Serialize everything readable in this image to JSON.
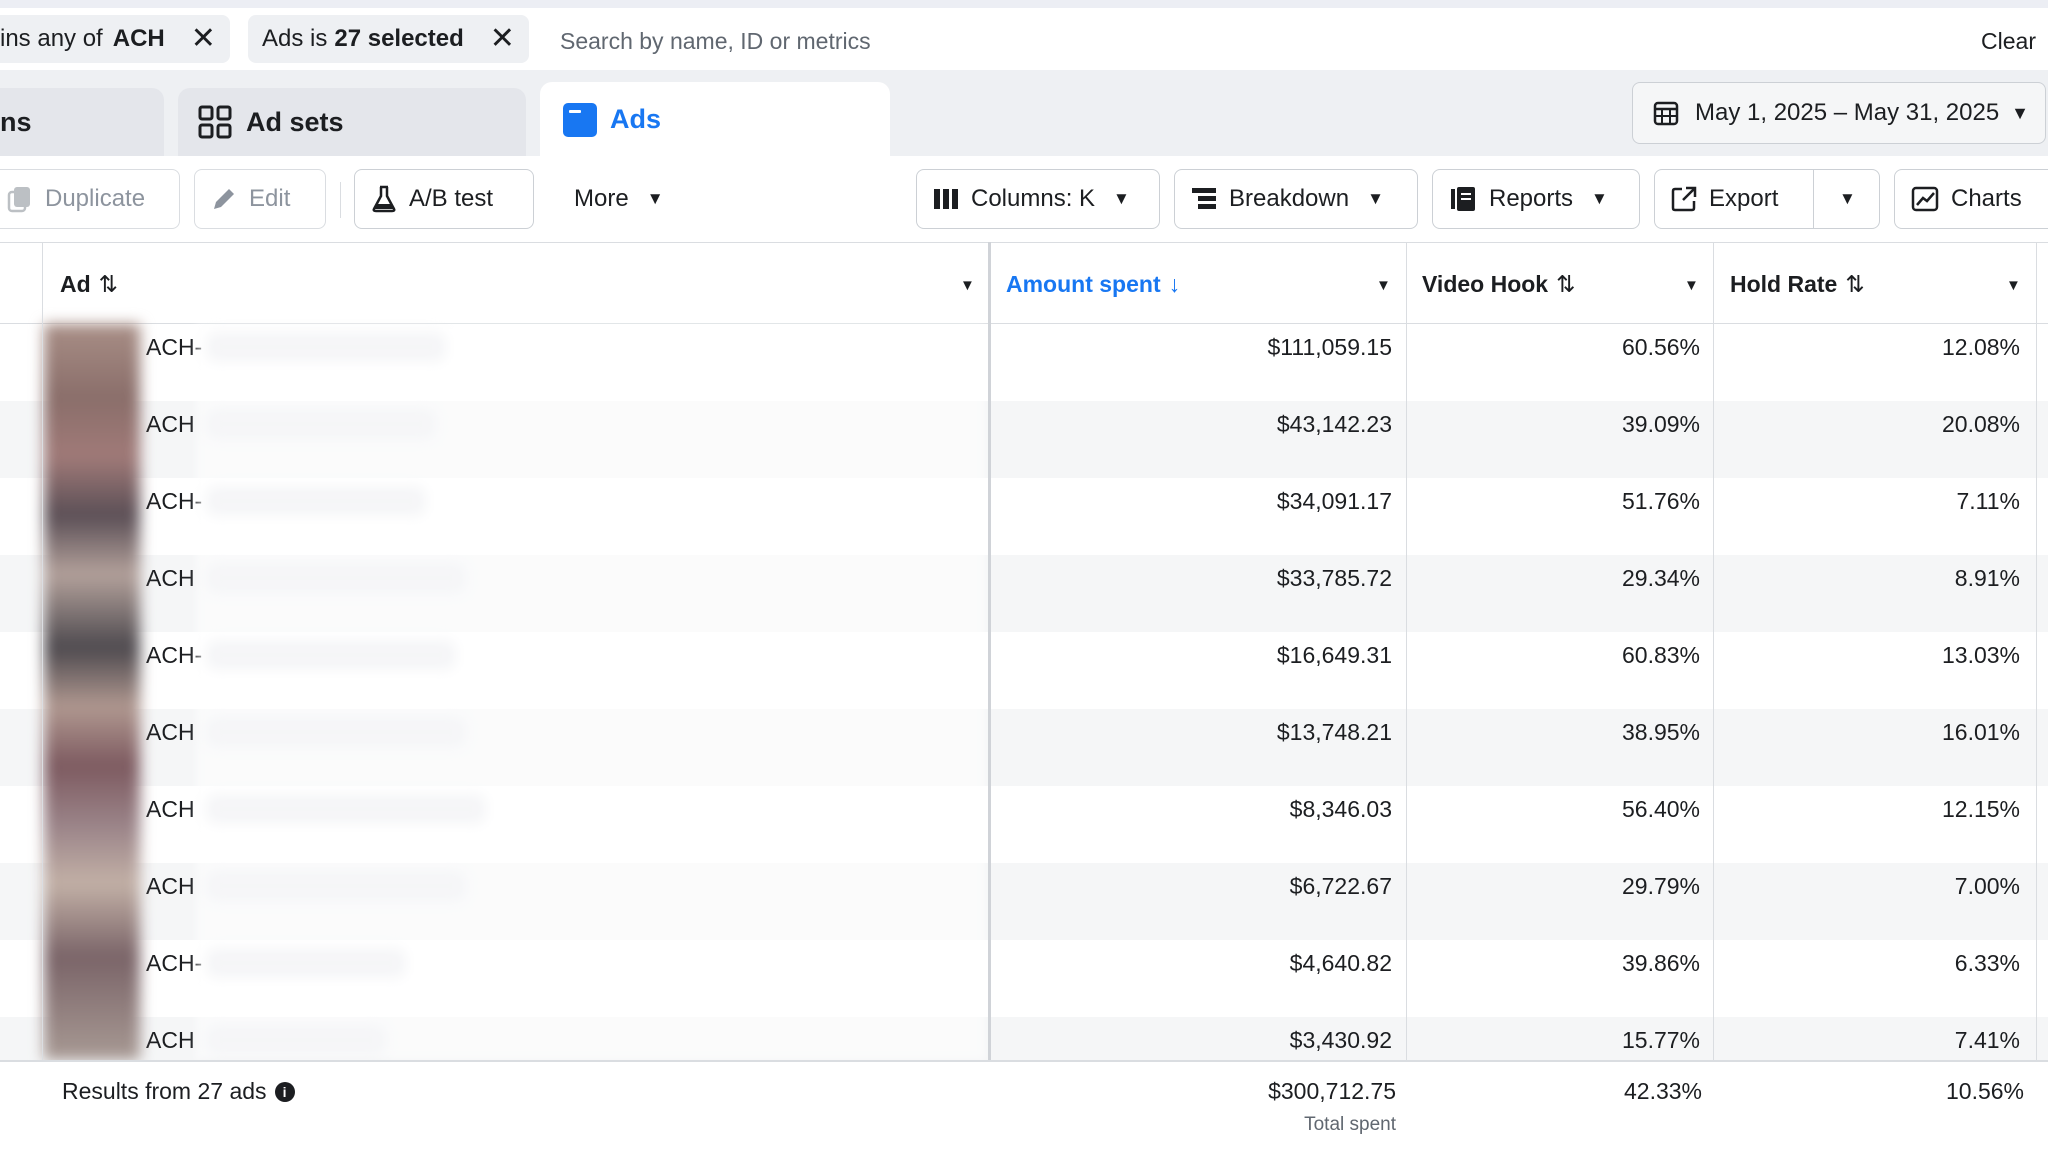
{
  "filters": {
    "chip1_prefix": "ins any of",
    "chip1_value": "ACH",
    "chip2_prefix": "Ads is",
    "chip2_value": "27 selected",
    "search_placeholder": "Search by name, ID or metrics",
    "clear_label": "Clear"
  },
  "tabs": {
    "campaigns_partial": "ns",
    "adsets": "Ad sets",
    "ads": "Ads"
  },
  "date_range": "May 1, 2025 – May 31, 2025",
  "toolbar": {
    "duplicate": "Duplicate",
    "edit": "Edit",
    "ab_test": "A/B test",
    "more": "More",
    "columns": "Columns: K",
    "breakdown": "Breakdown",
    "reports": "Reports",
    "export": "Export",
    "charts": "Charts"
  },
  "table": {
    "columns": {
      "ad": "Ad",
      "amount_spent": "Amount spent",
      "video_hook": "Video Hook",
      "hold_rate": "Hold Rate"
    },
    "rows": [
      {
        "name": "ACH-",
        "amount_spent": "$111,059.15",
        "video_hook": "60.56%",
        "hold_rate": "12.08%"
      },
      {
        "name": "ACH",
        "amount_spent": "$43,142.23",
        "video_hook": "39.09%",
        "hold_rate": "20.08%"
      },
      {
        "name": "ACH-",
        "amount_spent": "$34,091.17",
        "video_hook": "51.76%",
        "hold_rate": "7.11%"
      },
      {
        "name": "ACH",
        "amount_spent": "$33,785.72",
        "video_hook": "29.34%",
        "hold_rate": "8.91%"
      },
      {
        "name": "ACH-",
        "amount_spent": "$16,649.31",
        "video_hook": "60.83%",
        "hold_rate": "13.03%"
      },
      {
        "name": "ACH",
        "amount_spent": "$13,748.21",
        "video_hook": "38.95%",
        "hold_rate": "16.01%"
      },
      {
        "name": "ACH",
        "amount_spent": "$8,346.03",
        "video_hook": "56.40%",
        "hold_rate": "12.15%"
      },
      {
        "name": "ACH",
        "amount_spent": "$6,722.67",
        "video_hook": "29.79%",
        "hold_rate": "7.00%"
      },
      {
        "name": "ACH-",
        "amount_spent": "$4,640.82",
        "video_hook": "39.86%",
        "hold_rate": "6.33%"
      },
      {
        "name": "ACH",
        "amount_spent": "$3,430.92",
        "video_hook": "15.77%",
        "hold_rate": "7.41%"
      }
    ],
    "footer": {
      "label": "Results from 27 ads",
      "amount_spent": "$300,712.75",
      "amount_spent_sub": "Total spent",
      "video_hook": "42.33%",
      "hold_rate": "10.56%"
    }
  },
  "colors": {
    "accent": "#1877f2",
    "text": "#1c1e21",
    "muted": "#606770",
    "row_alt": "#f5f6f7"
  }
}
